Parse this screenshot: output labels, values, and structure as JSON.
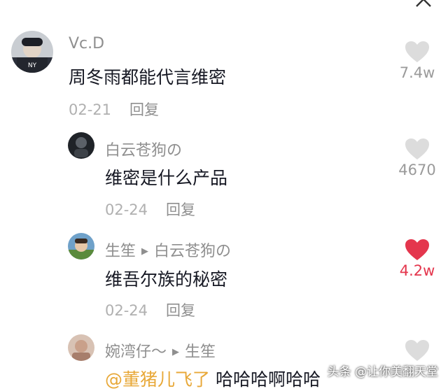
{
  "comments": [
    {
      "user": "Vc.D",
      "reply_to": "",
      "mention": "",
      "text": "周冬雨都能代言维密",
      "date": "02-21",
      "reply_label": "回复",
      "likes": "7.4w",
      "liked": false
    },
    {
      "user": "白云苍狗の",
      "reply_to": "",
      "mention": "",
      "text": "维密是什么产品",
      "date": "02-24",
      "reply_label": "回复",
      "likes": "4670",
      "liked": false
    },
    {
      "user": "生笙",
      "reply_to": "白云苍狗の",
      "mention": "",
      "text": "维吾尔族的秘密",
      "date": "02-24",
      "reply_label": "回复",
      "likes": "4.2w",
      "liked": true
    },
    {
      "user": "婉湾仔～",
      "reply_to": "生笙",
      "mention": "@董猪儿飞了",
      "text": " 哈哈哈啊哈哈",
      "date": "",
      "reply_label": "",
      "likes": "",
      "liked": false
    }
  ],
  "watermark": "头条 @让你美翻天堂",
  "colors": {
    "like_active": "#e4364d",
    "like_inactive": "#dcdcdc",
    "mention": "#e8a838"
  }
}
